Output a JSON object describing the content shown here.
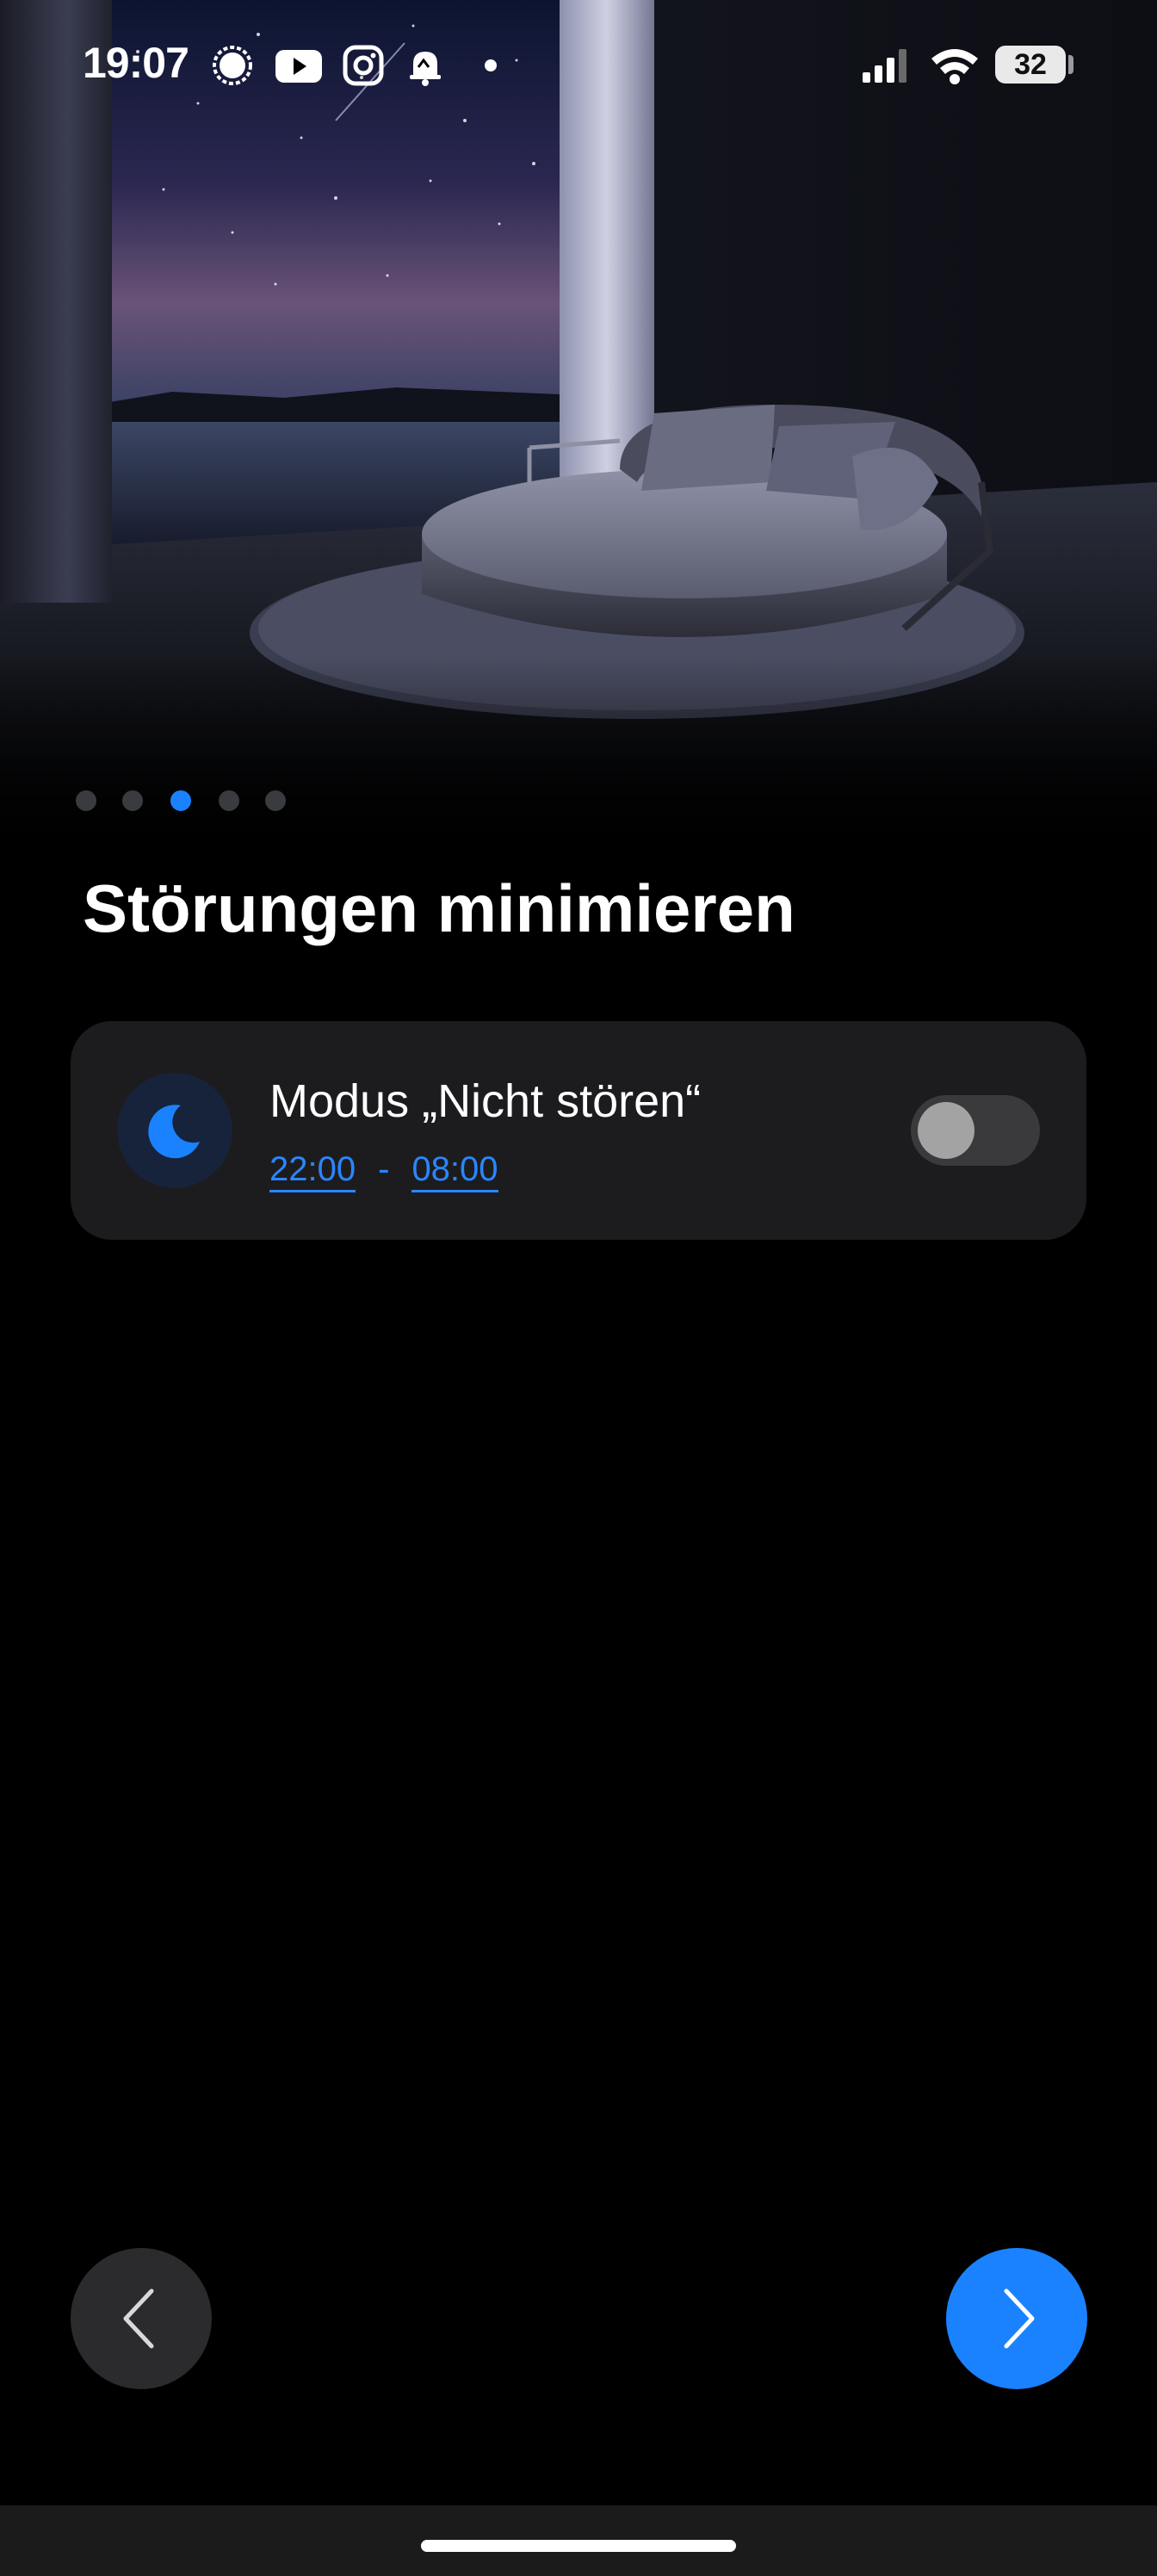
{
  "status_bar": {
    "time": "19:07",
    "notification_icons": [
      "signal-messenger-icon",
      "youtube-icon",
      "instagram-icon",
      "notification-bell-icon",
      "more-dot-icon"
    ],
    "system_icons": [
      "cellular-signal-icon",
      "wifi-icon"
    ],
    "battery_level": "32"
  },
  "hero": {
    "image": "round-bed-night-room-illustration"
  },
  "pager": {
    "total": 5,
    "active_index": 2
  },
  "page": {
    "title": "Störungen minimieren"
  },
  "dnd_card": {
    "icon": "moon-icon",
    "title": "Modus „Nicht stören“",
    "start_time": "22:00",
    "separator": "-",
    "end_time": "08:00",
    "enabled": false
  },
  "navigation": {
    "back_icon": "chevron-left-icon",
    "next_icon": "chevron-right-icon"
  },
  "colors": {
    "accent": "#1a82ff",
    "background": "#000000",
    "card": "#1c1c1e"
  }
}
